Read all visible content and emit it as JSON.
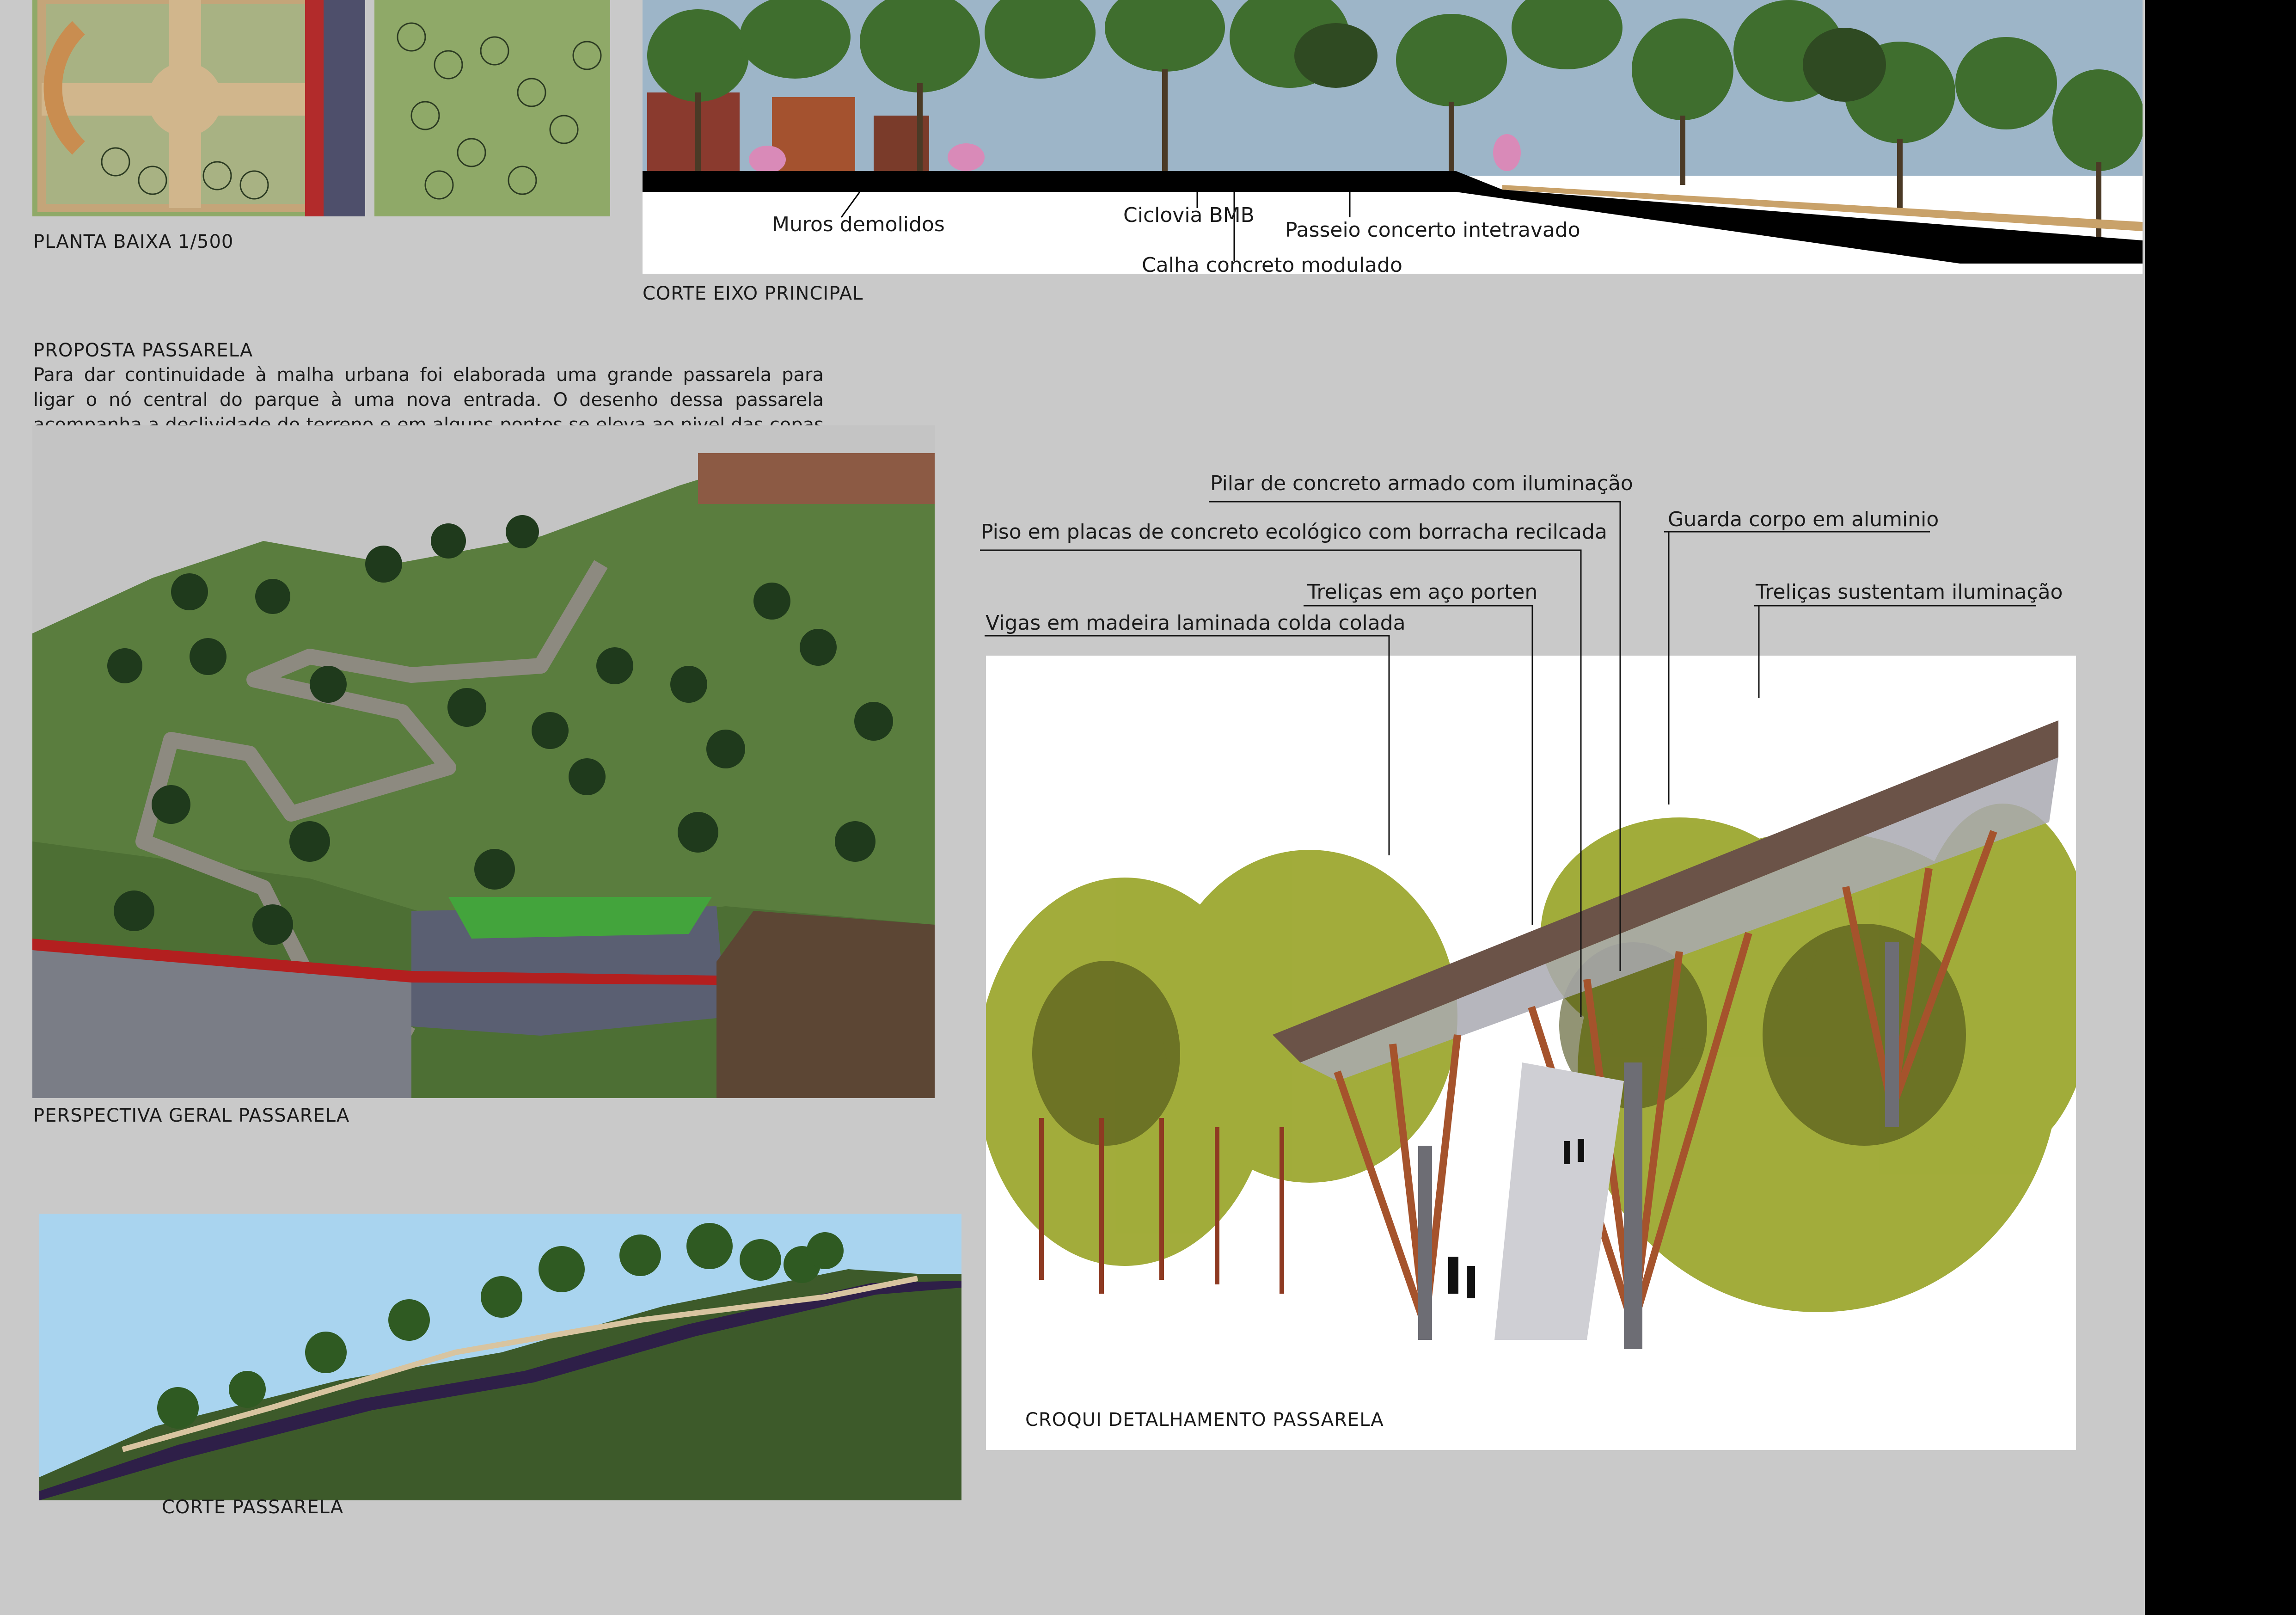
{
  "captions": {
    "plan": "PLANTA BAIXA 1/500",
    "main_section": "CORTE EIXO PRINCIPAL",
    "perspective": "PERSPECTIVA GERAL PASSARELA",
    "bridge_section": "CORTE PASSARELA",
    "sketch": "CROQUI DETALHAMENTO PASSARELA"
  },
  "proposal": {
    "title": "PROPOSTA PASSARELA",
    "text": "Para dar continuidade à malha urbana foi elaborada uma grande passarela para ligar o nó central do parque à uma nova entrada. O desenho dessa passarela acompanha a declividade do terreno e em alguns pontos se eleva ao nivel das copas das árvores tornando-a um extenso mirante que proporciona ao usuário uma nova perspectiva da cidade."
  },
  "section_labels": {
    "walls": "Muros demolidos",
    "bike": "Ciclovia BMB",
    "path": "Passeio concerto intetravado",
    "gutter": "Calha concreto modulado"
  },
  "sketch_labels": {
    "pillar": "Pilar de concreto armado com iluminação",
    "floor": "Piso em placas de concreto ecológico com borracha recilcada",
    "rail": "Guarda corpo em aluminio",
    "truss_steel": "Treliças em aço porten",
    "truss_light": "Treliças sustentam iluminação",
    "beams": "Vigas em madeira laminada colda colada"
  },
  "colors": {
    "background": "#c9c9c9",
    "grass": "#8fa968",
    "sky": "#9db5c8",
    "sky_light": "#a9d4ef",
    "tree": "#3f6e2e",
    "sketch_tree": "#9aa52a",
    "truss": "#a5532c"
  }
}
